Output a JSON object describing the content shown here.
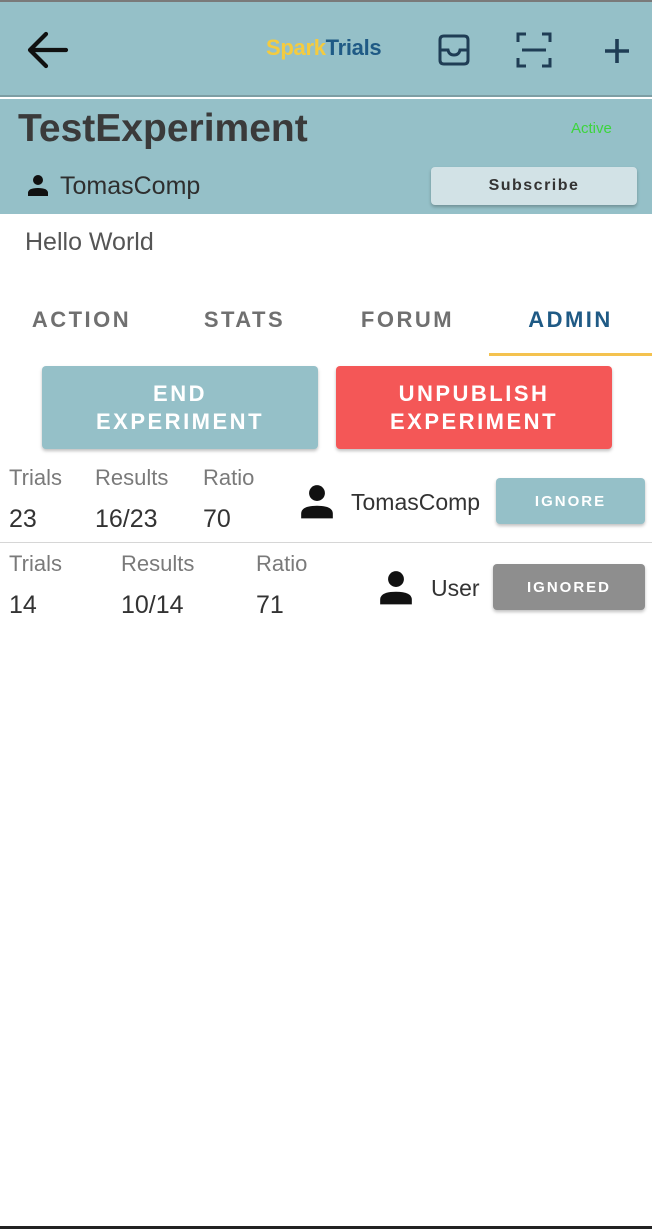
{
  "appbar": {
    "brand_part1": "Spark",
    "brand_part2": "Trials",
    "icons": [
      "back-arrow-icon",
      "inbox-icon",
      "qr-scan-icon",
      "plus-icon"
    ]
  },
  "experiment": {
    "title": "TestExperiment",
    "status": "Active",
    "owner": "TomasComp",
    "subscribe_label": "Subscribe",
    "description": "Hello World"
  },
  "tabs": [
    {
      "label": "ACTION",
      "active": false
    },
    {
      "label": "STATS",
      "active": false
    },
    {
      "label": "FORUM",
      "active": false
    },
    {
      "label": "ADMIN",
      "active": true
    }
  ],
  "actions": {
    "end_line1": "END",
    "end_line2": "EXPERIMENT",
    "unpublish_line1": "UNPUBLISH",
    "unpublish_line2": "EXPERIMENT"
  },
  "columns": {
    "trials": "Trials",
    "results": "Results",
    "ratio": "Ratio"
  },
  "participants": [
    {
      "trials": "23",
      "results": "16/23",
      "ratio": "70",
      "user": "TomasComp",
      "button": "IGNORE"
    },
    {
      "trials": "14",
      "results": "10/14",
      "ratio": "71",
      "user": "User",
      "button": "IGNORED"
    }
  ],
  "colors": {
    "bar": "#95c0c8",
    "brand_yellow": "#f4cb3f",
    "brand_blue": "#1f5a85",
    "active_green": "#3cd53c",
    "danger": "#f45757",
    "ignored_gray": "#8e8e8e",
    "tab_indicator": "#f4c24f"
  }
}
